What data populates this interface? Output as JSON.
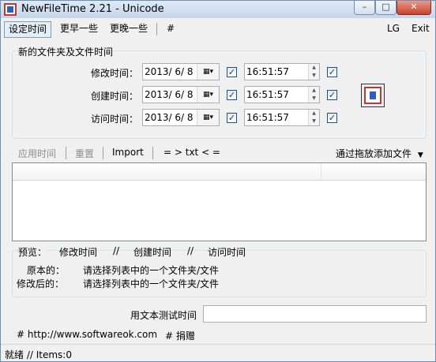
{
  "window": {
    "title": "NewFileTime 2.21 - Unicode"
  },
  "menu": {
    "set_time": "设定时间",
    "earlier": "更早一些",
    "later": "更晚一些",
    "hash": "#",
    "lg": "LG",
    "exit": "Exit"
  },
  "group": {
    "title": "新的文件夹及文件时间",
    "rows": [
      {
        "label": "修改时间：",
        "date": "2013/ 6/ 8",
        "date_checked": true,
        "time": "16:51:57",
        "time_checked": true
      },
      {
        "label": "创建时间：",
        "date": "2013/ 6/ 8",
        "date_checked": true,
        "time": "16:51:57",
        "time_checked": true
      },
      {
        "label": "访问时间：",
        "date": "2013/ 6/ 8",
        "date_checked": true,
        "time": "16:51:57",
        "time_checked": true
      }
    ]
  },
  "toolbar": {
    "apply": "应用时间",
    "reset": "重置",
    "import": "Import",
    "txt": "= > txt < =",
    "drag_add": "通过拖放添加文件"
  },
  "preview": {
    "label": "预览：",
    "modify": "修改时间",
    "sep1": "//",
    "create": "创建时间",
    "sep2": "//",
    "access": "访问时间",
    "original_label": "原本的：",
    "original_value": "请选择列表中的一个文件夹/文件",
    "modified_label": "修改后的：",
    "modified_value": "请选择列表中的一个文件夹/文件"
  },
  "test": {
    "label": "用文本测试时间",
    "value": ""
  },
  "links": {
    "website": "# http://www.softwareok.com",
    "donate": "# 捐赠"
  },
  "status": {
    "text": "就绪 // Items:0"
  }
}
